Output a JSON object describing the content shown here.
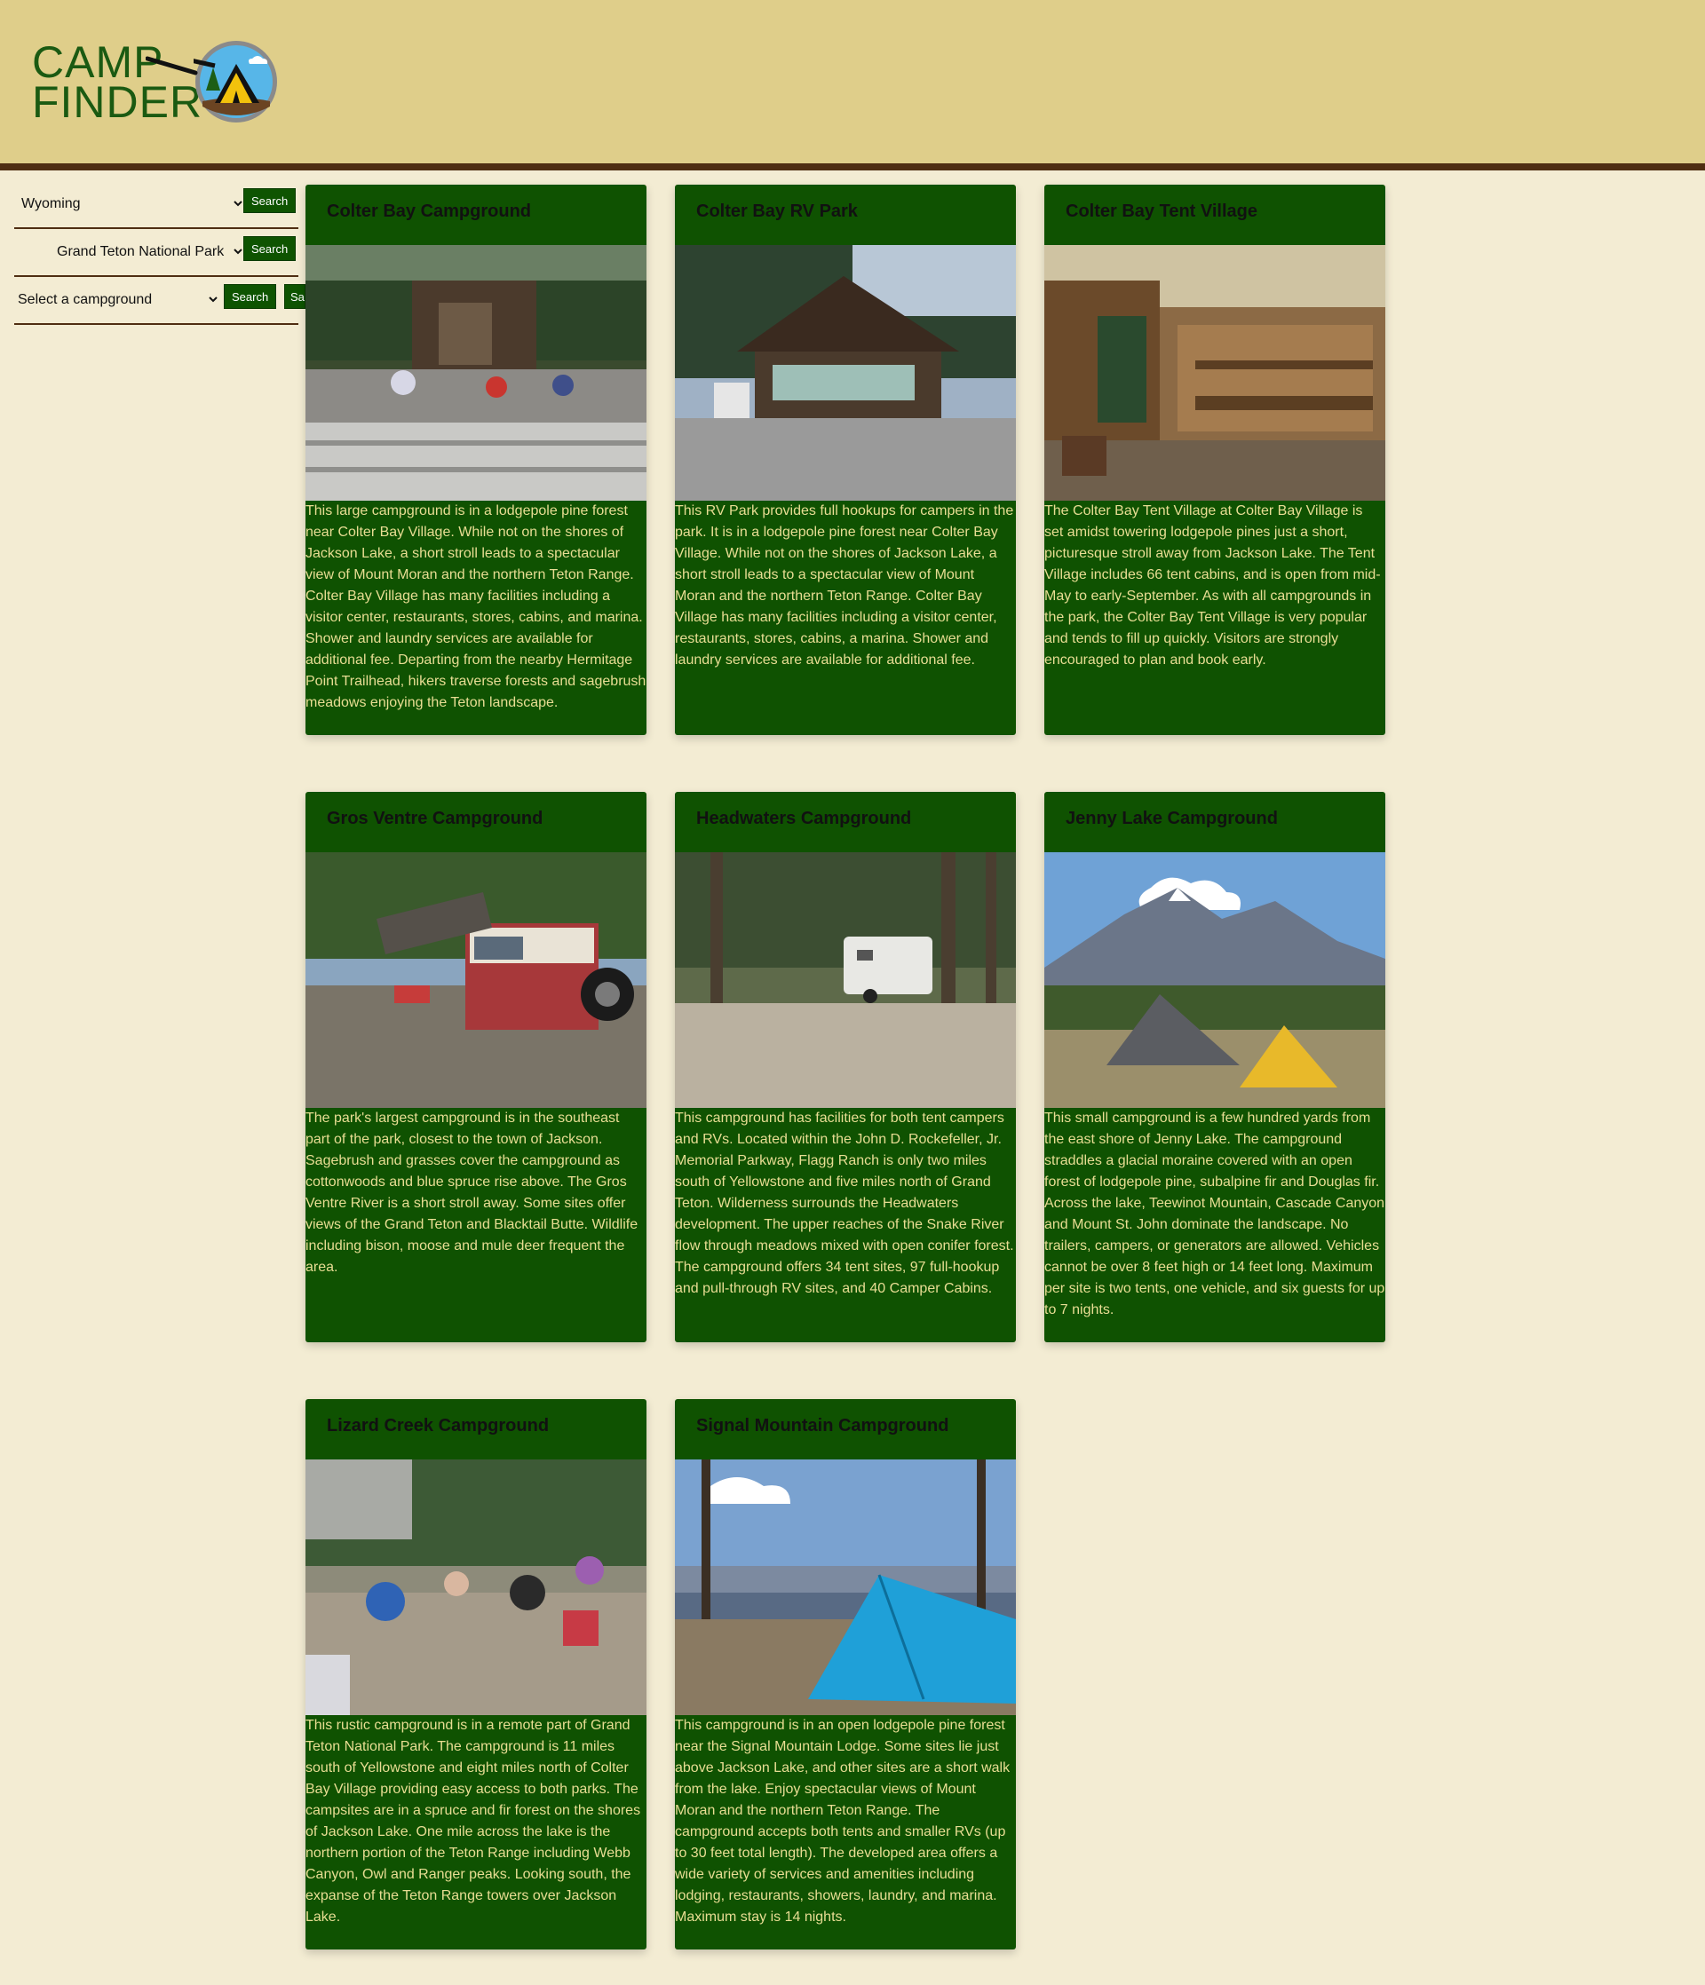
{
  "header": {
    "logo_line1": "CAMP",
    "logo_line2": "FINDER"
  },
  "sidebar": {
    "state_select": {
      "value": "Wyoming"
    },
    "state_search": "Search",
    "park_select": {
      "value": "Grand Teton National Park"
    },
    "park_search": "Search",
    "campground_select": {
      "value": "Select a campground"
    },
    "campground_search": "Search",
    "campground_extra": "Sa"
  },
  "cards": [
    {
      "title": "Colter Bay Campground",
      "desc": "This large campground is in a lodgepole pine forest near Colter Bay Village. While not on the shores of Jackson Lake, a short stroll leads to a spectacular view of Mount Moran and the northern Teton Range. Colter Bay Village has many facilities including a visitor center, restaurants, stores, cabins, and marina. Shower and laundry services are available for additional fee. Departing from the nearby Hermitage Point Trailhead, hikers traverse forests and sagebrush meadows enjoying the Teton landscape."
    },
    {
      "title": "Colter Bay RV Park",
      "desc": "This RV Park provides full hookups for campers in the park. It is in a lodgepole pine forest near Colter Bay Village. While not on the shores of Jackson Lake, a short stroll leads to a spectacular view of Mount Moran and the northern Teton Range. Colter Bay Village has many facilities including a visitor center, restaurants, stores, cabins, a marina. Shower and laundry services are available for additional fee."
    },
    {
      "title": "Colter Bay Tent Village",
      "desc": "The Colter Bay Tent Village at Colter Bay Village is set amidst towering lodgepole pines just a short, picturesque stroll away from Jackson Lake. The Tent Village includes 66 tent cabins, and is open from mid-May to early-September. As with all campgrounds in the park, the Colter Bay Tent Village is very popular and tends to fill up quickly. Visitors are strongly encouraged to plan and book early."
    },
    {
      "title": "Gros Ventre Campground",
      "desc": "The park's largest campground is in the southeast part of the park, closest to the town of Jackson. Sagebrush and grasses cover the campground as cottonwoods and blue spruce rise above. The Gros Ventre River is a short stroll away. Some sites offer views of the Grand Teton and Blacktail Butte. Wildlife including bison, moose and mule deer frequent the area."
    },
    {
      "title": "Headwaters Campground",
      "desc": "This campground has facilities for both tent campers and RVs. Located within the John D. Rockefeller, Jr. Memorial Parkway, Flagg Ranch is only two miles south of Yellowstone and five miles north of Grand Teton. Wilderness surrounds the Headwaters development. The upper reaches of the Snake River flow through meadows mixed with open conifer forest. The campground offers 34 tent sites, 97 full-hookup and pull-through RV sites, and 40 Camper Cabins."
    },
    {
      "title": "Jenny Lake Campground",
      "desc": "This small campground is a few hundred yards from the east shore of Jenny Lake. The campground straddles a glacial moraine covered with an open forest of lodgepole pine, subalpine fir and Douglas fir. Across the lake, Teewinot Mountain, Cascade Canyon and Mount St. John dominate the landscape. No trailers, campers, or generators are allowed. Vehicles cannot be over 8 feet high or 14 feet long. Maximum per site is two tents, one vehicle, and six guests for up to 7 nights."
    },
    {
      "title": "Lizard Creek Campground",
      "desc": "This rustic campground is in a remote part of Grand Teton National Park. The campground is 11 miles south of Yellowstone and eight miles north of Colter Bay Village providing easy access to both parks. The campsites are in a spruce and fir forest on the shores of Jackson Lake. One mile across the lake is the northern portion of the Teton Range including Webb Canyon, Owl and Ranger peaks. Looking south, the expanse of the Teton Range towers over Jackson Lake."
    },
    {
      "title": "Signal Mountain Campground",
      "desc": "This campground is in an open lodgepole pine forest near the Signal Mountain Lodge. Some sites lie just above Jackson Lake, and other sites are a short walk from the lake. Enjoy spectacular views of Mount Moran and the northern Teton Range. The campground accepts both tents and smaller RVs (up to 30 feet total length). The developed area offers a wide variety of services and amenities including lodging, restaurants, showers, laundry, and marina. Maximum stay is 14 nights."
    }
  ]
}
